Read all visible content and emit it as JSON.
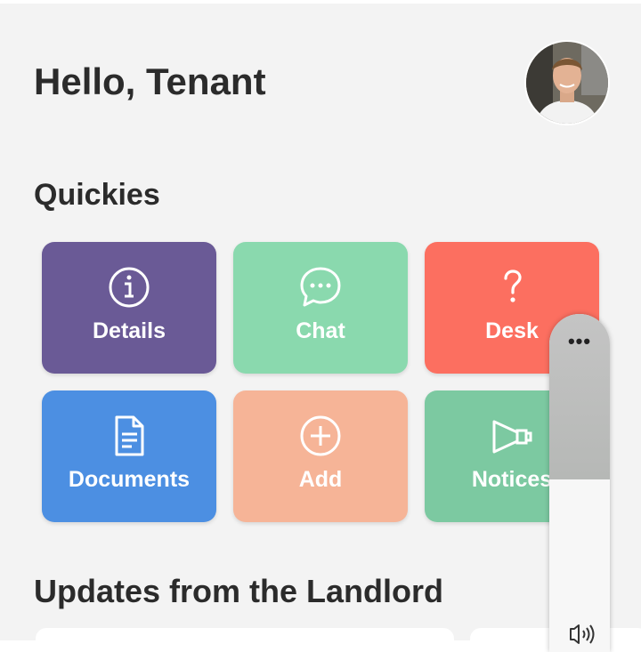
{
  "header": {
    "greeting": "Hello, Tenant",
    "avatar_icon": "user-avatar"
  },
  "quickies": {
    "title": "Quickies",
    "tiles": [
      {
        "label": "Details",
        "icon": "info-icon",
        "color": "#6a5a96"
      },
      {
        "label": "Chat",
        "icon": "chat-icon",
        "color": "#8ad9ae"
      },
      {
        "label": "Desk",
        "icon": "question-icon",
        "color": "#fc6f60"
      },
      {
        "label": "Documents",
        "icon": "document-icon",
        "color": "#4c8fe2"
      },
      {
        "label": "Add",
        "icon": "plus-circle-icon",
        "color": "#f6b497"
      },
      {
        "label": "Notices",
        "icon": "megaphone-icon",
        "color": "#7cc9a1"
      }
    ]
  },
  "updates": {
    "title": "Updates from the Landlord"
  },
  "overlay": {
    "menu_icon": "more-icon",
    "menu_glyph": "•••",
    "audio_icon": "sound-icon"
  },
  "colors": {
    "background": "#f3f3f3",
    "text": "#2b2b2b"
  }
}
